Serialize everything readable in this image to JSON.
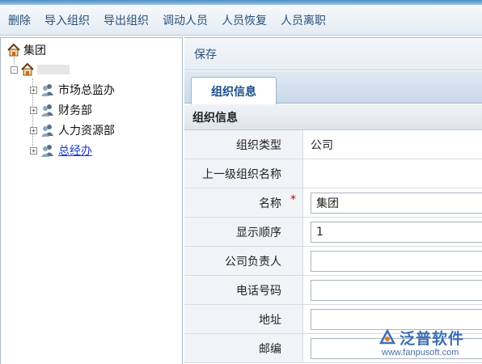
{
  "toolbar": {
    "buttons": [
      "删除",
      "导入组织",
      "导出组织",
      "调动人员",
      "人员恢复",
      "人员离职"
    ]
  },
  "tree": {
    "root": {
      "label": "集团",
      "icon": "house-icon"
    },
    "child": {
      "label": "",
      "icon": "house-icon"
    },
    "departments": [
      {
        "label": "市场总监办",
        "icon": "people-icon",
        "link": false
      },
      {
        "label": "财务部",
        "icon": "people-icon",
        "link": false
      },
      {
        "label": "人力资源部",
        "icon": "people-icon",
        "link": false
      },
      {
        "label": "总经办",
        "icon": "people-icon",
        "link": true
      }
    ]
  },
  "panel": {
    "save_label": "保存",
    "tab_label": "组织信息",
    "section_title": "组织信息"
  },
  "form": {
    "fields": [
      {
        "label": "组织类型",
        "value": "公司",
        "type": "text",
        "required": false
      },
      {
        "label": "上一级组织名称",
        "value": "",
        "type": "text",
        "required": false
      },
      {
        "label": "名称",
        "value": "集团",
        "type": "input",
        "required": true
      },
      {
        "label": "显示顺序",
        "value": "1",
        "type": "input",
        "required": false
      },
      {
        "label": "公司负责人",
        "value": "",
        "type": "input",
        "required": false
      },
      {
        "label": "电话号码",
        "value": "",
        "type": "input",
        "required": false
      },
      {
        "label": "地址",
        "value": "",
        "type": "input",
        "required": false
      },
      {
        "label": "邮编",
        "value": "",
        "type": "input",
        "required": false
      }
    ],
    "required_mark": "*"
  },
  "watermark": {
    "name": "泛普软件",
    "url": "www.fanpusoft.com"
  },
  "colors": {
    "toolbar_text": "#2c4f78",
    "link": "#1a3bd0",
    "required": "#cc0000",
    "tab_text": "#1a4d8a"
  }
}
